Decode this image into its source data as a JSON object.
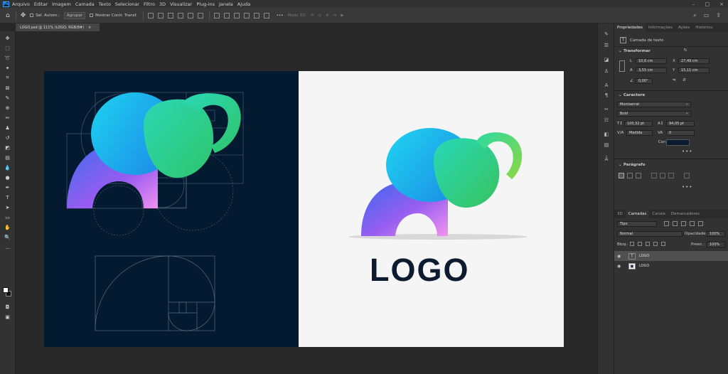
{
  "app": {
    "icon_label": "Ps"
  },
  "menu": [
    "Arquivo",
    "Editar",
    "Imagem",
    "Camada",
    "Texto",
    "Selecionar",
    "Filtro",
    "3D",
    "Visualizar",
    "Plug-ins",
    "Janela",
    "Ajuda"
  ],
  "options_bar": {
    "auto_select_label": "Sel. Autom.:",
    "group_select": "Agrupar",
    "show_transform_label": "Mostrar Contr. Transf.",
    "mode3d_label": "Modo 3D:"
  },
  "document_tab": {
    "title": "LOGO.psd @ 111% (LOGO, RGB/8#)",
    "close": "×"
  },
  "canvas": {
    "logo_text": "LOGO",
    "left_bg": "#031a31",
    "right_bg": "#f5f5f5"
  },
  "properties_panel": {
    "tabs": [
      "Propriedades",
      "Informações",
      "Ações",
      "Histórico"
    ],
    "layer_type": "Camada de texto",
    "transform": {
      "title": "Transformar",
      "w_label": "L",
      "w_value": "10,6 cm",
      "h_label": "A",
      "h_value": "3,55 cm",
      "x_label": "X",
      "x_value": "27,49 cm",
      "y_label": "Y",
      "y_value": "15,11 cm",
      "angle_value": "0,00°"
    },
    "character": {
      "title": "Caractere",
      "font": "Montserrat",
      "style": "Bold",
      "size": "100,32 pt",
      "leading": "94,05 pt",
      "kerning": "Medida",
      "tracking": "0",
      "color_label": "Cor:",
      "color": "#0c1b30"
    },
    "paragraph": {
      "title": "Parágrafo"
    },
    "more": "•••"
  },
  "layers_panel": {
    "tabs": [
      "3D",
      "Camadas",
      "Canais",
      "Demarcadores"
    ],
    "filter": "Tipo",
    "blend_mode": "Normal",
    "opacity_label": "Opacidade:",
    "opacity_value": "100%",
    "lock_label": "Bloq.:",
    "fill_label": "Preen.:",
    "fill_value": "100%",
    "layers": [
      {
        "name": "LOGO",
        "thumb": "T",
        "selected": true
      },
      {
        "name": "LOGO",
        "thumb": "▣",
        "selected": false
      }
    ]
  },
  "colors": {
    "accent_cyan": "#21c6e8",
    "accent_green": "#3bd36b",
    "accent_purple": "#8a5cf6"
  }
}
